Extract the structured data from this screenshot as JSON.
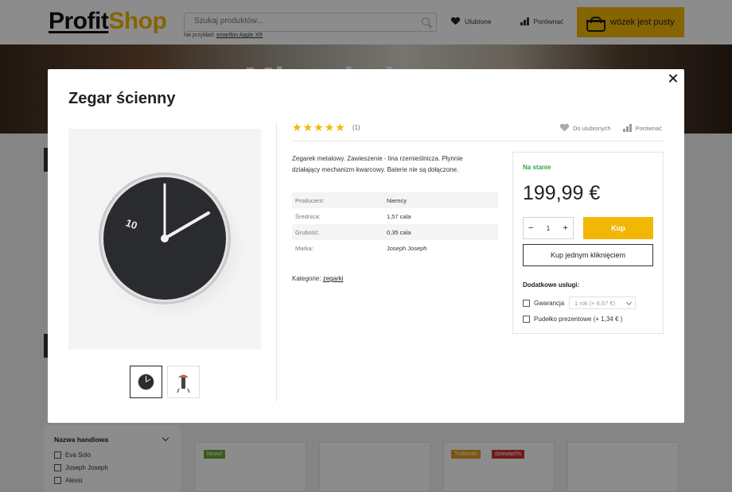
{
  "header": {
    "logo_part1": "Profit",
    "logo_part2": "Shop",
    "search_placeholder": "Szukaj produktów...",
    "search_hint_prefix": "Na przykład:",
    "search_hint_link": "smartfon Apple XR",
    "favorites_label": "Ulubione",
    "compare_label": "Porównać",
    "cart_label": "wózek jest pusty",
    "accent_color": "#f2b705"
  },
  "hero": {
    "title": "Mieszkalnowy"
  },
  "filter": {
    "title": "Nazwa handlowa",
    "options": [
      "Eva Solo",
      "Joseph Joseph",
      "Alessi"
    ]
  },
  "badges": {
    "new": "Nowy!",
    "hit": "Trafienie!",
    "sale": "dziewięć%"
  },
  "modal": {
    "title": "Zegar ścienny",
    "rating": {
      "stars": 5,
      "count": "(1)"
    },
    "favorite_label": "Do ulubionych",
    "compare_label": "Porównać",
    "description": "Zegarek metalowy. Zawieszenie - lina rzemieślnicza. Płynnie działający mechanizm kwarcowy. Baterie nie są dołączone.",
    "specs": [
      {
        "key": "Producent:",
        "value": "Niemcy"
      },
      {
        "key": "Średnica:",
        "value": "1,57 cala"
      },
      {
        "key": "Grubość:",
        "value": "0,35 cala"
      },
      {
        "key": "Marka:",
        "value": "Joseph Joseph"
      }
    ],
    "categories_label": "Kategorie:",
    "categories_link": "zegarki",
    "buy_box": {
      "stock": "Na stanie",
      "price": "199,99 €",
      "qty_minus": "−",
      "qty_value": "1",
      "qty_plus": "+",
      "buy_label": "Kup",
      "one_click_label": "Kup jednym kliknięciem",
      "services_title": "Dodatkowe usługi:",
      "warranty_label": "Gwarancja",
      "warranty_option": "1 rok (+ 6,67 €)",
      "giftbox_label": "Pudełko prezentowe (+ 1,34 € )",
      "stock_color": "#2aa84a"
    }
  }
}
